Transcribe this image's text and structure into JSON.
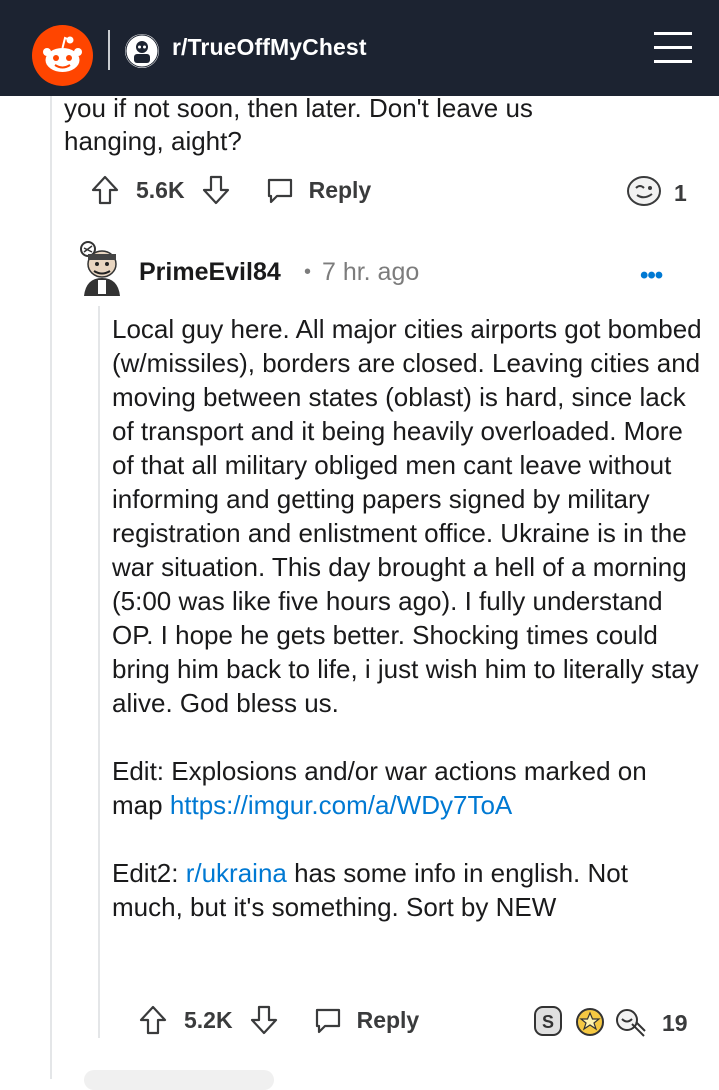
{
  "header": {
    "subreddit": "r/TrueOffMyChest"
  },
  "parent_comment": {
    "text_lines": [
      "you if not soon, then later. Don't leave us",
      "hanging, aight?"
    ],
    "upvotes": "5.6K",
    "reply_label": "Reply",
    "award_count": "1"
  },
  "comment": {
    "username": "PrimeEvil84",
    "time": "7 hr. ago",
    "more_label": "•••",
    "paragraph1": "Local guy here. All major cities airports got bombed (w/missiles), borders are closed. Leaving cities and moving between states (oblast) is hard, since lack of transport and it being heavily overloaded. More of that all military obliged men cant leave without informing and getting papers signed by military registration and enlistment office. Ukraine is in the war situation. This day brought a hell of a morning (5:00 was like five hours ago). I fully understand OP. I hope he gets better. Shocking times could bring him back to life, i just wish him to literally stay alive. God bless us.",
    "edit1_text": "Edit: Explosions and/or war actions marked on map ",
    "edit1_link": "https://imgur.com/a/WDy7ToA",
    "edit2_prefix": "Edit2: ",
    "edit2_link": "r/ukraina",
    "edit2_text": " has some info in english. Not much, but it's something. Sort by NEW",
    "upvotes": "5.2K",
    "reply_label": "Reply",
    "award_count": "19"
  },
  "colors": {
    "header_bg": "#1c2331",
    "reddit_orange": "#ff4500",
    "link_blue": "#0079d3",
    "meta_gray": "#7c7c7c"
  },
  "icons": [
    "reddit-logo-icon",
    "subreddit-icon",
    "hamburger-menu-icon",
    "upvote-icon",
    "downvote-icon",
    "reply-icon",
    "award-icon",
    "avatar",
    "silver-award-icon",
    "gold-award-icon",
    "wholesome-award-icon"
  ]
}
